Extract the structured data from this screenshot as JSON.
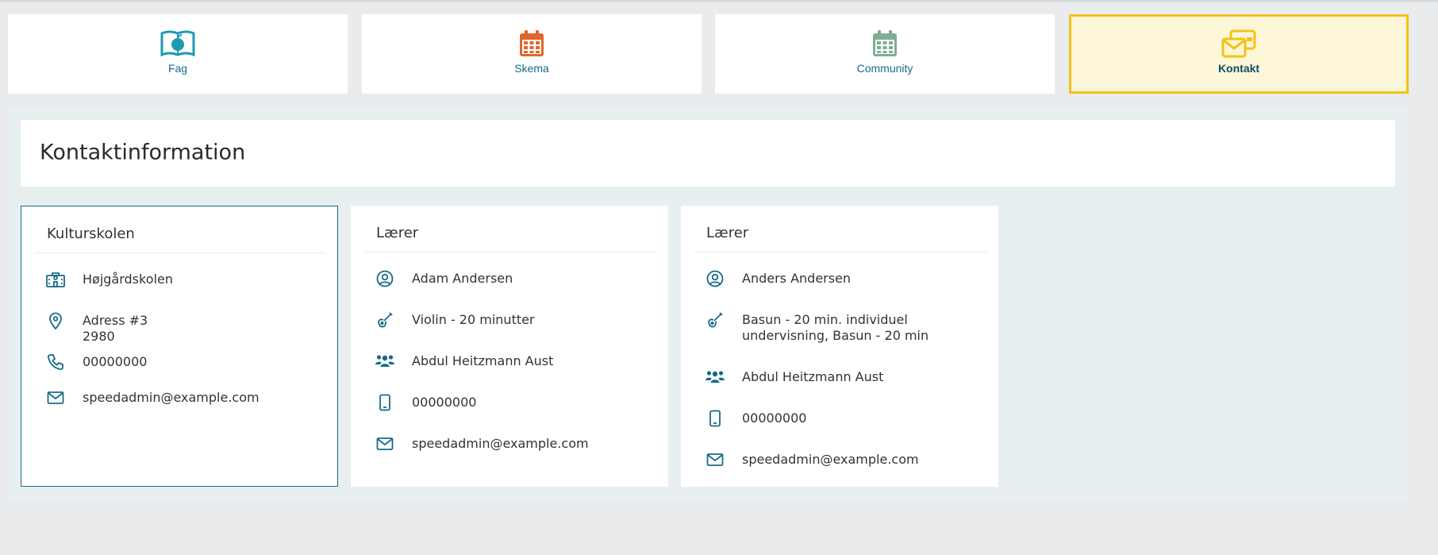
{
  "colors": {
    "accent": "#186b87",
    "active_tab_bg": "#fdf6d8",
    "active_tab_border": "#f2c315"
  },
  "tabs": [
    {
      "label": "Fag",
      "icon": "book-apple-icon",
      "icon_color": "#1d9bb0"
    },
    {
      "label": "Skema",
      "icon": "calendar-icon",
      "icon_color": "#e0662b"
    },
    {
      "label": "Community",
      "icon": "calendar-icon",
      "icon_color": "#7fae96"
    },
    {
      "label": "Kontakt",
      "icon": "envelopes-icon",
      "icon_color": "#f2c315",
      "active": true
    }
  ],
  "page_title": "Kontaktinformation",
  "school_card": {
    "title": "Kulturskolen",
    "name": "Højgårdskolen",
    "address_line1": "Adress #3",
    "address_line2": "2980",
    "phone": "00000000",
    "email": "speedadmin@example.com"
  },
  "teacher_cards": [
    {
      "title": "Lærer",
      "name": "Adam Andersen",
      "instrument_line1": "Violin - 20 minutter",
      "instrument_line2": "",
      "group": "Abdul Heitzmann Aust",
      "mobile": "00000000",
      "email": "speedadmin@example.com"
    },
    {
      "title": "Lærer",
      "name": "Anders Andersen",
      "instrument_line1": "Basun - 20 min. individuel",
      "instrument_line2": "undervisning, Basun - 20 min",
      "group": "Abdul Heitzmann Aust",
      "mobile": "00000000",
      "email": "speedadmin@example.com"
    }
  ]
}
